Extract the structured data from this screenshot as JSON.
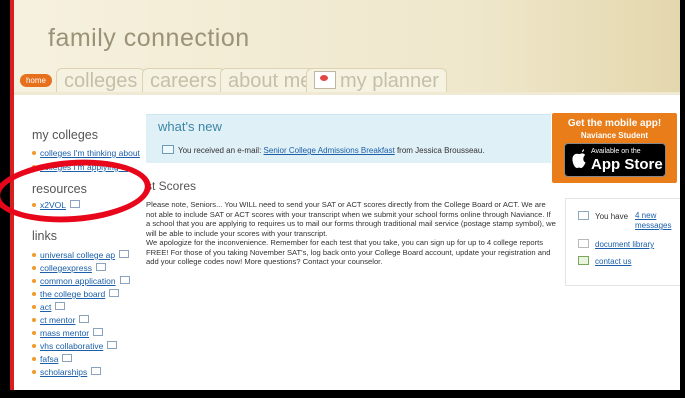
{
  "header": {
    "brand": "family connection",
    "tabs": {
      "home": "home",
      "colleges": "colleges",
      "careers": "careers",
      "about_me": "about me",
      "my_planner": "my planner"
    }
  },
  "sidebar": {
    "my_colleges_title": "my colleges",
    "my_colleges_items": [
      "colleges I'm thinking about",
      "colleges I'm applying to"
    ],
    "resources_title": "resources",
    "resources_items": [
      "x2VOL"
    ],
    "links_title": "links",
    "links_items": [
      "universal college ap",
      "collegexpress",
      "common application",
      "the college board",
      "act",
      "ct mentor",
      "mass mentor",
      "vhs collaborative",
      "fafsa",
      "scholarships"
    ]
  },
  "whats_new": {
    "title": "what's new",
    "message_prefix": "You received an e-mail: ",
    "message_link": "Senior College Admissions Breakfast",
    "message_suffix": " from Jessica Brousseau."
  },
  "test_scores": {
    "title": "st Scores",
    "body_1": "Please note, Seniors... You WILL need to send your SAT or ACT scores directly from the College Board or ACT. We are not able to include SAT or ACT scores with your transcript when we submit your school forms online through Naviance. If a school that you are applying to requires us to mail our forms through traditional mail service (postage stamp symbol), we will be able to include your scores with your transcript.",
    "body_2": "We apologize for the inconvenience. Remember for each test that you take, you can sign up for up to 4 college reports FREE! For those of you taking November SAT's, log back onto your College Board account, update your registration and add your college codes now! More questions? Contact your counselor."
  },
  "app_badge": {
    "line1": "Get the mobile app!",
    "line2": "Naviance Student",
    "store_small": "Available on the",
    "store_big": "App Store"
  },
  "right_panel": {
    "messages_prefix": "You have ",
    "messages_link": "4 new messages",
    "document_library": "document library",
    "contact_us": "contact us"
  },
  "colors": {
    "accent_orange": "#e87d1a",
    "link_blue": "#1b5fa8",
    "annotation_red": "#e8061b"
  }
}
